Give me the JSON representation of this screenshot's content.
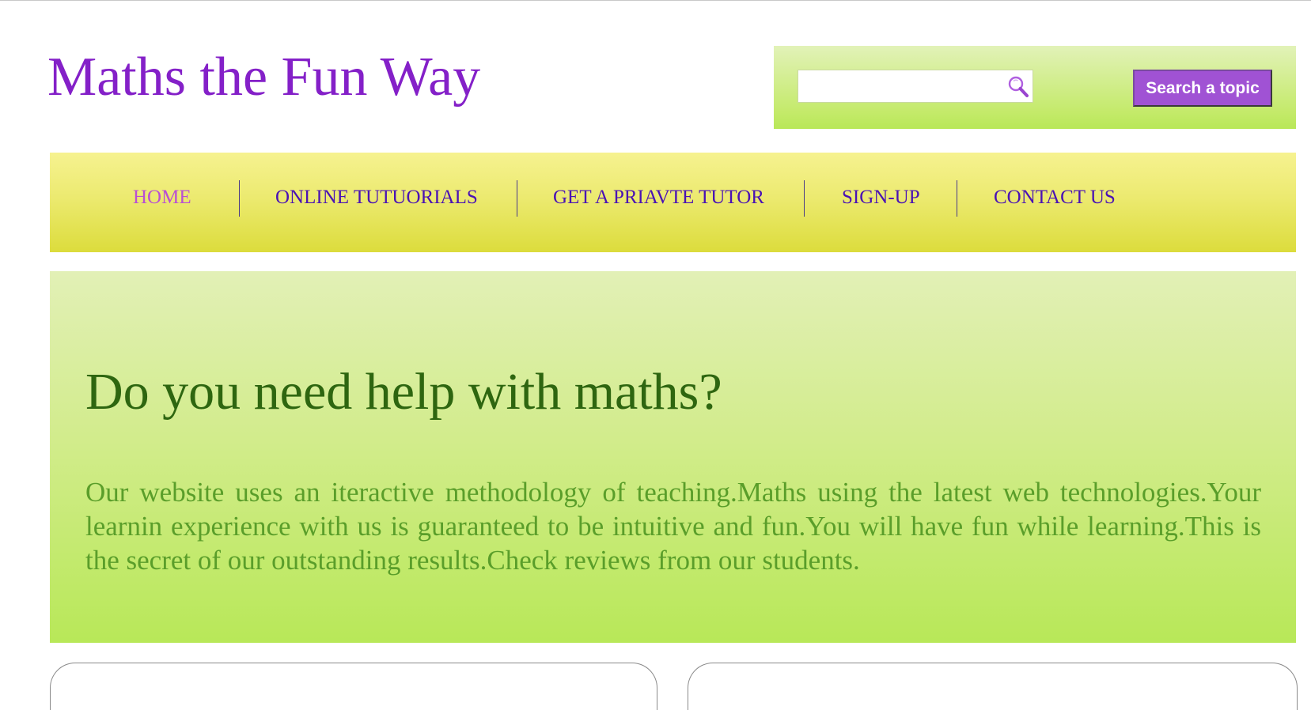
{
  "header": {
    "title": "Maths the Fun Way"
  },
  "search": {
    "value": "",
    "placeholder": "",
    "icon": "search-icon",
    "button_label": "Search a topic"
  },
  "nav": {
    "items": [
      {
        "label": "HOME",
        "active": true
      },
      {
        "label": "ONLINE TUTUORIALS",
        "active": false
      },
      {
        "label": "GET A PRIAVTE TUTOR",
        "active": false
      },
      {
        "label": "SIGN-UP",
        "active": false
      },
      {
        "label": "CONTACT US",
        "active": false
      }
    ]
  },
  "hero": {
    "heading": "Do you need help with maths?",
    "body": "Our website uses an iteractive methodology of teaching.Maths using the latest web technologies.Your learnin experience with us is guaranteed to be intuitive and fun.You will have fun while learning.This is the secret of our outstanding results.Check reviews from our students."
  },
  "colors": {
    "title": "#8420c8",
    "nav_link": "#4a12b4",
    "nav_active": "#b94fd4",
    "search_button": "#a052d4",
    "hero_heading": "#2e6610",
    "hero_text": "#5a9e2a"
  }
}
